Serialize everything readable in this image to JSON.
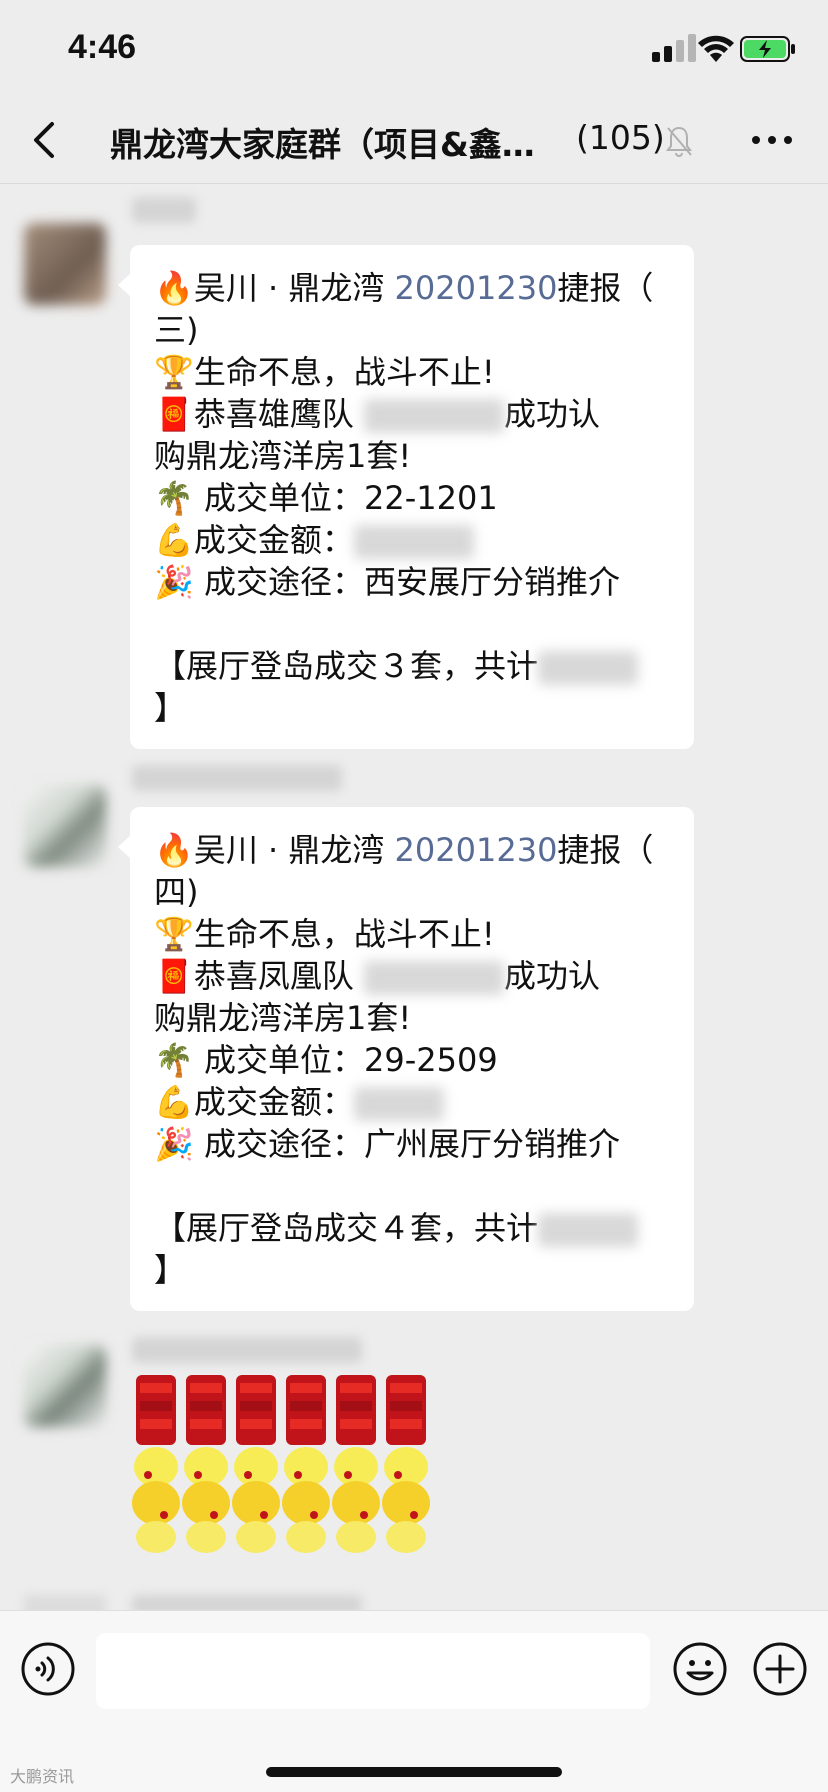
{
  "status_bar": {
    "time": "4:46"
  },
  "header": {
    "title": "鼎龙湾大家庭群（项目&鑫…",
    "member_count": "(105)"
  },
  "messages": [
    {
      "lines": [
        {
          "emoji": "🔥",
          "pre": "吴川 · 鼎龙湾 ",
          "date": "20201230",
          "post": "捷报（"
        },
        {
          "text": "三)"
        },
        {
          "emoji": "🏆",
          "text": "生命不息，战斗不止!"
        },
        {
          "emoji": "🧧",
          "pre": "恭喜雄鹰队 ",
          "post": "成功认"
        },
        {
          "text": "购鼎龙湾洋房1套!"
        },
        {
          "emoji": "🌴",
          "text": " 成交单位：22-1201"
        },
        {
          "emoji": "💪",
          "text": "成交金额："
        },
        {
          "emoji": "🎉",
          "text": " 成交途径：西安展厅分销推介"
        },
        {
          "text": ""
        },
        {
          "text": "【展厅登岛成交３套，共计"
        },
        {
          "text": "】"
        }
      ]
    },
    {
      "lines": [
        {
          "emoji": "🔥",
          "pre": "吴川 · 鼎龙湾 ",
          "date": "20201230",
          "post": "捷报（"
        },
        {
          "text": "四)"
        },
        {
          "emoji": "🏆",
          "text": "生命不息，战斗不止!"
        },
        {
          "emoji": "🧧",
          "pre": "恭喜凤凰队 ",
          "post": "成功认"
        },
        {
          "text": "购鼎龙湾洋房1套!"
        },
        {
          "emoji": "🌴",
          "text": " 成交单位：29-2509"
        },
        {
          "emoji": "💪",
          "text": "成交金额："
        },
        {
          "emoji": "🎉",
          "text": " 成交途径：广州展厅分销推介"
        },
        {
          "text": ""
        },
        {
          "text": "【展厅登岛成交４套，共计"
        },
        {
          "text": "】"
        }
      ]
    }
  ],
  "watermark": "大鹏资讯",
  "colors": {
    "link": "#576b95",
    "bubble": "#ffffff",
    "background": "#ededed"
  },
  "icons": [
    "back-icon",
    "mute-bell-icon",
    "more-icon",
    "voice-icon",
    "emoji-icon",
    "plus-icon",
    "signal-icon",
    "wifi-icon",
    "battery-icon"
  ]
}
